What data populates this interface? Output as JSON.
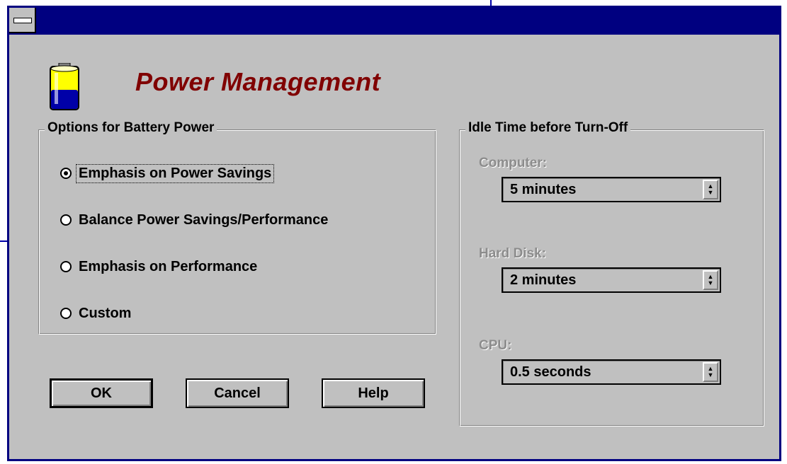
{
  "window": {
    "title": "",
    "heading": "Power Management"
  },
  "battery_group": {
    "label": "Options for Battery Power",
    "options": [
      {
        "label": "Emphasis on Power Savings",
        "selected": true
      },
      {
        "label": "Balance Power Savings/Performance",
        "selected": false
      },
      {
        "label": "Emphasis on Performance",
        "selected": false
      },
      {
        "label": "Custom",
        "selected": false
      }
    ]
  },
  "idle_group": {
    "label": "Idle Time before Turn-Off",
    "fields": [
      {
        "label": "Computer:",
        "value": "5 minutes"
      },
      {
        "label": "Hard Disk:",
        "value": "2 minutes"
      },
      {
        "label": "CPU:",
        "value": "0.5 seconds"
      }
    ]
  },
  "buttons": {
    "ok": "OK",
    "cancel": "Cancel",
    "help": "Help"
  },
  "icons": {
    "battery": "battery-icon",
    "system_menu": "system-menu-icon",
    "spin": "spin-arrows-icon"
  },
  "colors": {
    "title_bar": "#000080",
    "face": "#c0c0c0",
    "heading": "#800000",
    "disabled_text": "#8c8c8c"
  }
}
